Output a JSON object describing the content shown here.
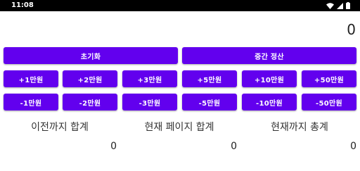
{
  "status_bar": {
    "time": "11:08",
    "icons": [
      "wifi-icon",
      "signal-icon",
      "battery-icon"
    ]
  },
  "display": {
    "value": "0"
  },
  "actions": {
    "reset_label": "초기화",
    "settle_label": "중간 정산"
  },
  "plus_buttons": [
    "+1만원",
    "+2만원",
    "+3만원",
    "+5만원",
    "+10만원",
    "+50만원"
  ],
  "minus_buttons": [
    "-1만원",
    "-2만원",
    "-3만원",
    "-5만원",
    "-10만원",
    "-50만원"
  ],
  "totals": [
    {
      "label": "이전까지 합계",
      "value": "0"
    },
    {
      "label": "현재 페이지 합계",
      "value": "0"
    },
    {
      "label": "현재까지 총계",
      "value": "0"
    }
  ],
  "colors": {
    "accent": "#6200ee",
    "status_bar": "#000000"
  }
}
